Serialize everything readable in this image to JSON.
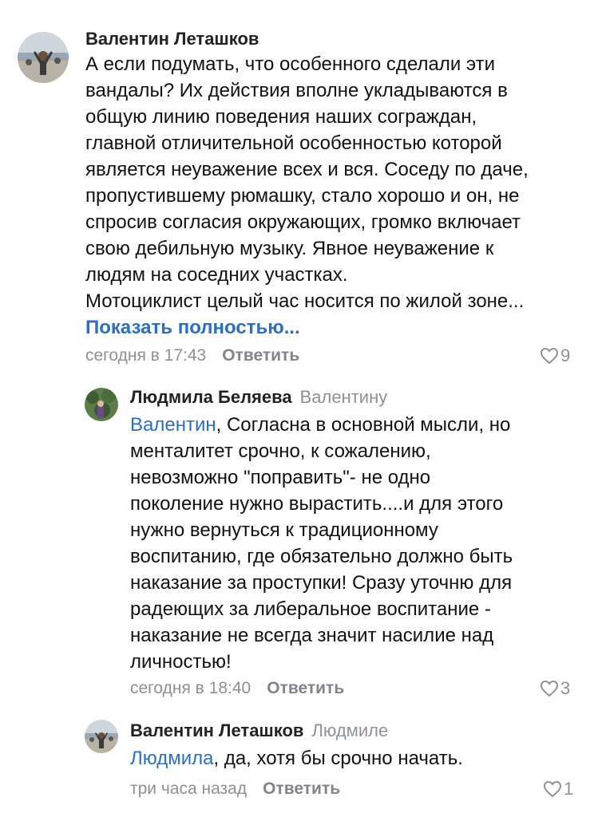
{
  "comments": [
    {
      "author": "Валентин Леташков",
      "reply_to": "",
      "mention": "",
      "lines": [
        "А если подумать, что особенного сделали эти",
        "вандалы? Их действия вполне укладываются в",
        "общую линию поведения наших сограждан,",
        "главной отличительной особенностью которой",
        "является неуважение всех и вся. Соседу по даче,",
        "пропустившему рюмашку, стало хорошо и он, не",
        "спросив согласия окружающих, громко включает",
        "свою дебильную музыку. Явное неуважение к",
        "людям на соседних участках.",
        "Мотоциклист целый час носится по жилой зоне..."
      ],
      "show_more": "Показать полностью...",
      "time": "сегодня в 17:43",
      "reply_label": "Ответить",
      "likes": "9",
      "icon": "heart-icon"
    },
    {
      "author": "Людмила Беляева",
      "reply_to": "Валентину",
      "mention": "Валентин",
      "first_line_rest": ", Согласна в основной мысли, но",
      "lines": [
        "менталитет срочно, к сожалению,",
        "невозможно \"поправить\"- не  одно",
        "поколение нужно вырастить....и для этого",
        "нужно вернуться к традиционному",
        "воспитанию, где обязательно должно быть",
        "наказание за проступки! Сразу уточню для",
        "радеющих за либеральное воспитание -",
        "наказание не всегда значит насилие над",
        "личностью!"
      ],
      "time": "сегодня в 18:40",
      "reply_label": "Ответить",
      "likes": "3",
      "icon": "heart-icon"
    },
    {
      "author": "Валентин Леташков",
      "reply_to": "Людмиле",
      "mention": "Людмила",
      "first_line_rest": ", да, хотя бы срочно начать.",
      "lines": [],
      "time": "три часа назад",
      "reply_label": "Ответить",
      "likes": "1",
      "icon": "heart-icon"
    }
  ],
  "colors": {
    "link": "#2a6fc4",
    "muted": "#8c9199",
    "text": "#111111"
  }
}
